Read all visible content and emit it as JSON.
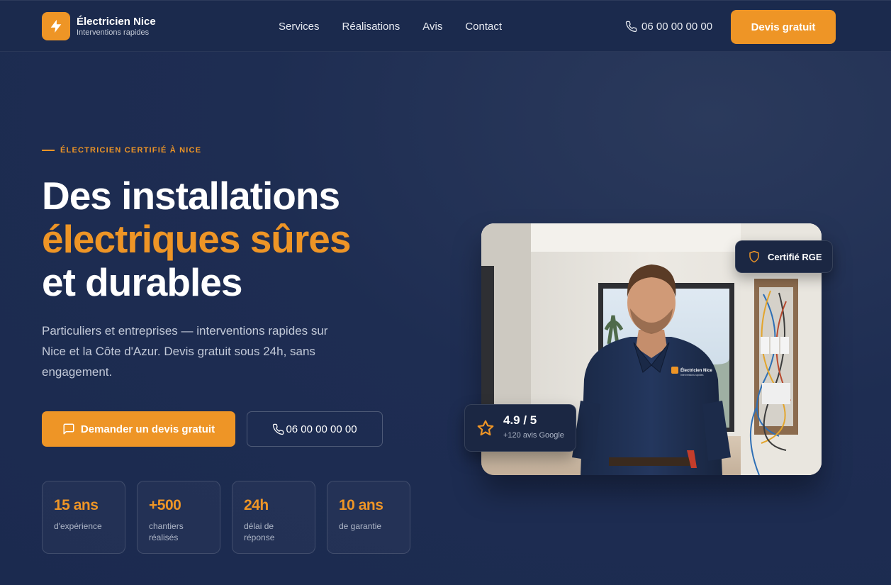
{
  "header": {
    "brand_title": "Électricien Nice",
    "brand_subtitle": "Interventions rapides",
    "nav": [
      "Services",
      "Réalisations",
      "Avis",
      "Contact"
    ],
    "phone": "06 00 00 00 00",
    "cta": "Devis gratuit"
  },
  "hero": {
    "eyebrow": "ÉLECTRICIEN CERTIFIÉ À NICE",
    "headline_line1": "Des installations",
    "headline_line2": "électriques sûres",
    "headline_line3": "et durables",
    "lead": "Particuliers et entreprises — interventions rapides sur Nice et la Côte d'Azur. Devis gratuit sous 24h, sans engagement.",
    "primary_cta": "Demander un devis gratuit",
    "secondary_cta": "06 00 00 00 00",
    "stats": [
      {
        "value": "15 ans",
        "label": "d'expérience"
      },
      {
        "value": "+500",
        "label": "chantiers réalisés"
      },
      {
        "value": "24h",
        "label": "délai de réponse"
      },
      {
        "value": "10 ans",
        "label": "de garantie"
      }
    ]
  },
  "visual": {
    "badge_text": "Certifié RGE",
    "rating_score": "4.9 / 5",
    "rating_sub": "+120 avis Google",
    "shirt_logo_title": "Électricien Nice",
    "shirt_logo_sub": "Interventions rapides"
  },
  "icons": {
    "brand": "lightning-bolt-icon",
    "phone": "phone-icon",
    "chat": "message-square-icon",
    "shield": "shield-icon",
    "star": "star-icon"
  },
  "colors": {
    "accent": "#ee9526",
    "background": "#1e2d52",
    "header": "#1b2a4d",
    "card": "#1b2743"
  }
}
